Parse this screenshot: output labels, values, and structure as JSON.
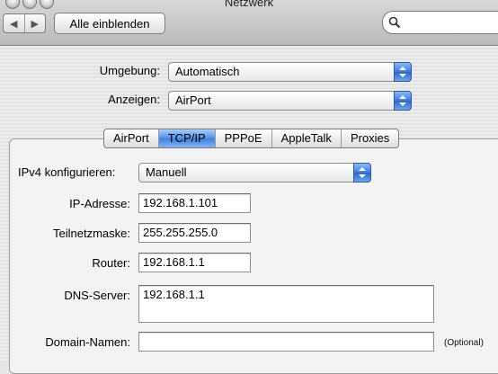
{
  "window": {
    "title": "Netzwerk"
  },
  "toolbar": {
    "back_icon": "left-arrow",
    "forward_icon": "right-arrow",
    "show_all_label": "Alle einblenden",
    "search_icon": "magnifier",
    "search_value": ""
  },
  "location": {
    "label": "Umgebung:",
    "value": "Automatisch"
  },
  "show": {
    "label": "Anzeigen:",
    "value": "AirPort"
  },
  "tabs": [
    {
      "label": "AirPort",
      "active": false
    },
    {
      "label": "TCP/IP",
      "active": true
    },
    {
      "label": "PPPoE",
      "active": false
    },
    {
      "label": "AppleTalk",
      "active": false
    },
    {
      "label": "Proxies",
      "active": false
    }
  ],
  "ipv4": {
    "label": "IPv4 konfigurieren:",
    "value": "Manuell"
  },
  "ip_address": {
    "label": "IP-Adresse:",
    "value": "192.168.1.101"
  },
  "subnet_mask": {
    "label": "Teilnetzmaske:",
    "value": "255.255.255.0"
  },
  "router": {
    "label": "Router:",
    "value": "192.168.1.1"
  },
  "dns": {
    "label": "DNS-Server:",
    "value": "192.168.1.1"
  },
  "domains": {
    "label": "Domain-Namen:",
    "value": "",
    "hint": "(Optional)"
  },
  "colors": {
    "accent": "#3f7fdc",
    "toolbar": "#c8c8c8"
  }
}
